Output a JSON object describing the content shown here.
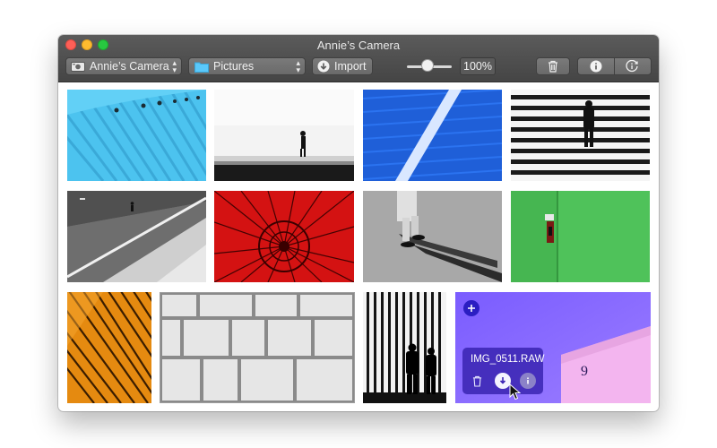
{
  "window": {
    "title": "Annie’s Camera"
  },
  "toolbar": {
    "device_label": "Annie’s Camera",
    "folder_label": "Pictures",
    "import_label": "Import",
    "zoom_value": "100%"
  },
  "selected_photo": {
    "filename": "IMG_0511.RAW"
  },
  "icons": {
    "device": "camera-icon",
    "folder": "folder-icon",
    "import": "download-icon",
    "delete": "trash-icon",
    "info": "info-icon",
    "rotate_info": "info-rotate-icon",
    "add": "plus-icon",
    "cursor": "pointer-cursor"
  },
  "colors": {
    "folder_accent": "#5ac8fa",
    "overlay": "#3a22b4",
    "selected_tile": "#8a6dff"
  }
}
